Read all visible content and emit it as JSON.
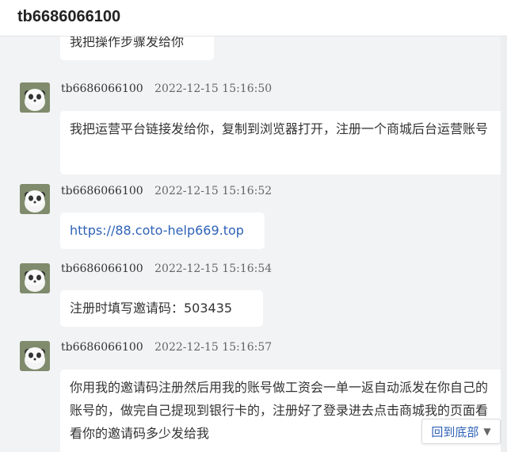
{
  "header": {
    "title": "tb6686066100"
  },
  "messages": [
    {
      "text": "我把操作步骤发给你"
    },
    {
      "name": "tb6686066100",
      "time": "2022-12-15 15:16:50",
      "text": "我把运营平台链接发给你，复制到浏览器打开，注册一个商城后台运营账号"
    },
    {
      "name": "tb6686066100",
      "time": "2022-12-15 15:16:52",
      "text": "https://88.coto-help669.top"
    },
    {
      "name": "tb6686066100",
      "time": "2022-12-15 15:16:54",
      "text": "注册时填写邀请码：503435"
    },
    {
      "name": "tb6686066100",
      "time": "2022-12-15 15:16:57",
      "text": "你用我的邀请码注册然后用我的账号做工资会一单一返自动派发在你自己的账号的，做完自己提现到银行卡的，注册好了登录进去点击商城我的页面看看你的邀请码多少发给我"
    }
  ],
  "back_to_bottom": {
    "label": "回到底部",
    "icon": "chevron-down-icon"
  },
  "colors": {
    "link": "#2f62b7",
    "bubble": "#ffffff",
    "background": "#f2f3f5"
  }
}
